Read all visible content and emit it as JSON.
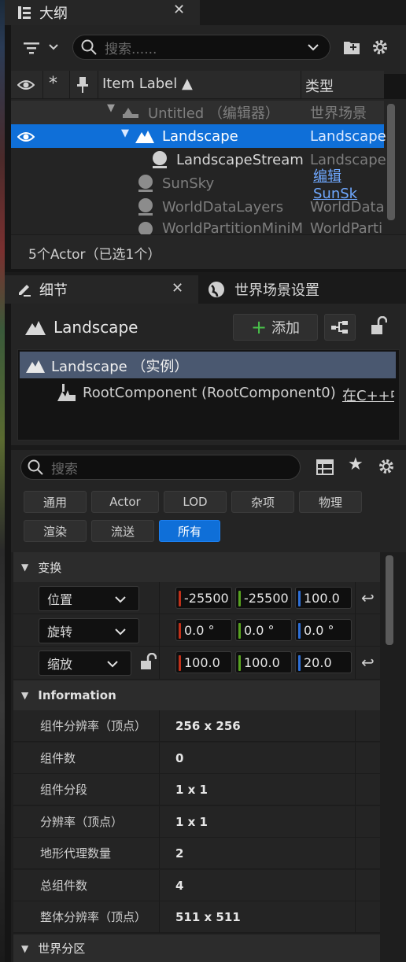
{
  "outliner": {
    "tab_title": "大纲",
    "search_placeholder": "搜索......",
    "columns": {
      "label": "Item Label ▲",
      "type": "类型"
    },
    "rows": [
      {
        "label": "Untitled （编辑器）",
        "type": "世界场景"
      },
      {
        "label": "Landscape",
        "type": "Landscape"
      },
      {
        "label": "LandscapeStream",
        "type": "Landscape"
      },
      {
        "label": "SunSky",
        "type": "编辑SunSk"
      },
      {
        "label": "WorldDataLayers",
        "type": "WorldData"
      },
      {
        "label": "WorldPartitionMiniM",
        "type": "WorldParti"
      }
    ],
    "status": "5个Actor（已选1个）"
  },
  "details": {
    "tab_title": "细节",
    "world_tab_title": "世界场景设置",
    "actor_name": "Landscape",
    "add_label": "添加",
    "tree": {
      "root": "Landscape （实例）",
      "child": "RootComponent (RootComponent0)",
      "child_link": "在C++中"
    },
    "search_placeholder": "搜索",
    "filters_row1": [
      "通用",
      "Actor",
      "LOD",
      "杂项",
      "物理"
    ],
    "filters_row2": [
      "渲染",
      "流送",
      "所有"
    ],
    "transform": {
      "section": "变换",
      "location": {
        "label": "位置",
        "x": "-25500",
        "y": "-25500",
        "z": "100.0"
      },
      "rotation": {
        "label": "旋转",
        "x": "0.0 °",
        "y": "0.0 °",
        "z": "0.0 °"
      },
      "scale": {
        "label": "缩放",
        "x": "100.0",
        "y": "100.0",
        "z": "20.0"
      }
    },
    "information": {
      "section": "Information",
      "props": [
        {
          "k": "组件分辨率（顶点）",
          "v": "256 x 256"
        },
        {
          "k": "组件数",
          "v": "0"
        },
        {
          "k": "组件分段",
          "v": "1 x 1"
        },
        {
          "k": "分辨率（顶点）",
          "v": "1 x 1"
        },
        {
          "k": "地形代理数量",
          "v": "2"
        },
        {
          "k": "总组件数",
          "v": "4"
        },
        {
          "k": "整体分辨率（顶点）",
          "v": "511 x 511"
        }
      ]
    },
    "world_partition_section": "世界分区"
  }
}
